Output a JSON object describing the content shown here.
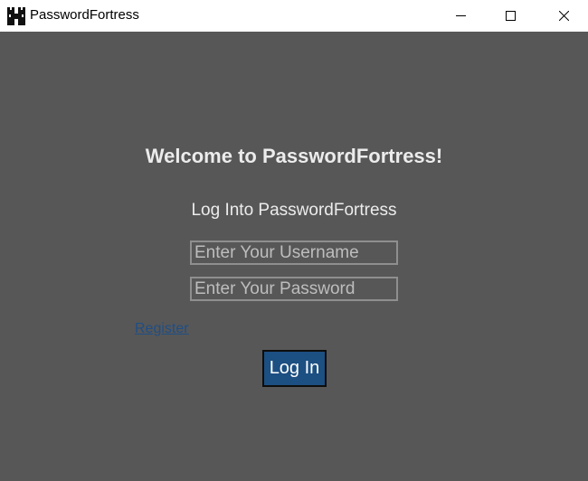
{
  "window": {
    "title": "PasswordFortress",
    "icon": "fortress-icon",
    "controls": [
      "minimize-icon",
      "maximize-icon",
      "close-icon"
    ]
  },
  "main": {
    "welcome": "Welcome to PasswordFortress!",
    "subtitle": "Log Into PasswordFortress",
    "username_placeholder": "Enter Your Username",
    "password_placeholder": "Enter Your Password",
    "register_link": "Register",
    "login_button": "Log In"
  },
  "colors": {
    "background": "#575757",
    "login_button": "#1c4f82",
    "link": "#1f4e86"
  }
}
